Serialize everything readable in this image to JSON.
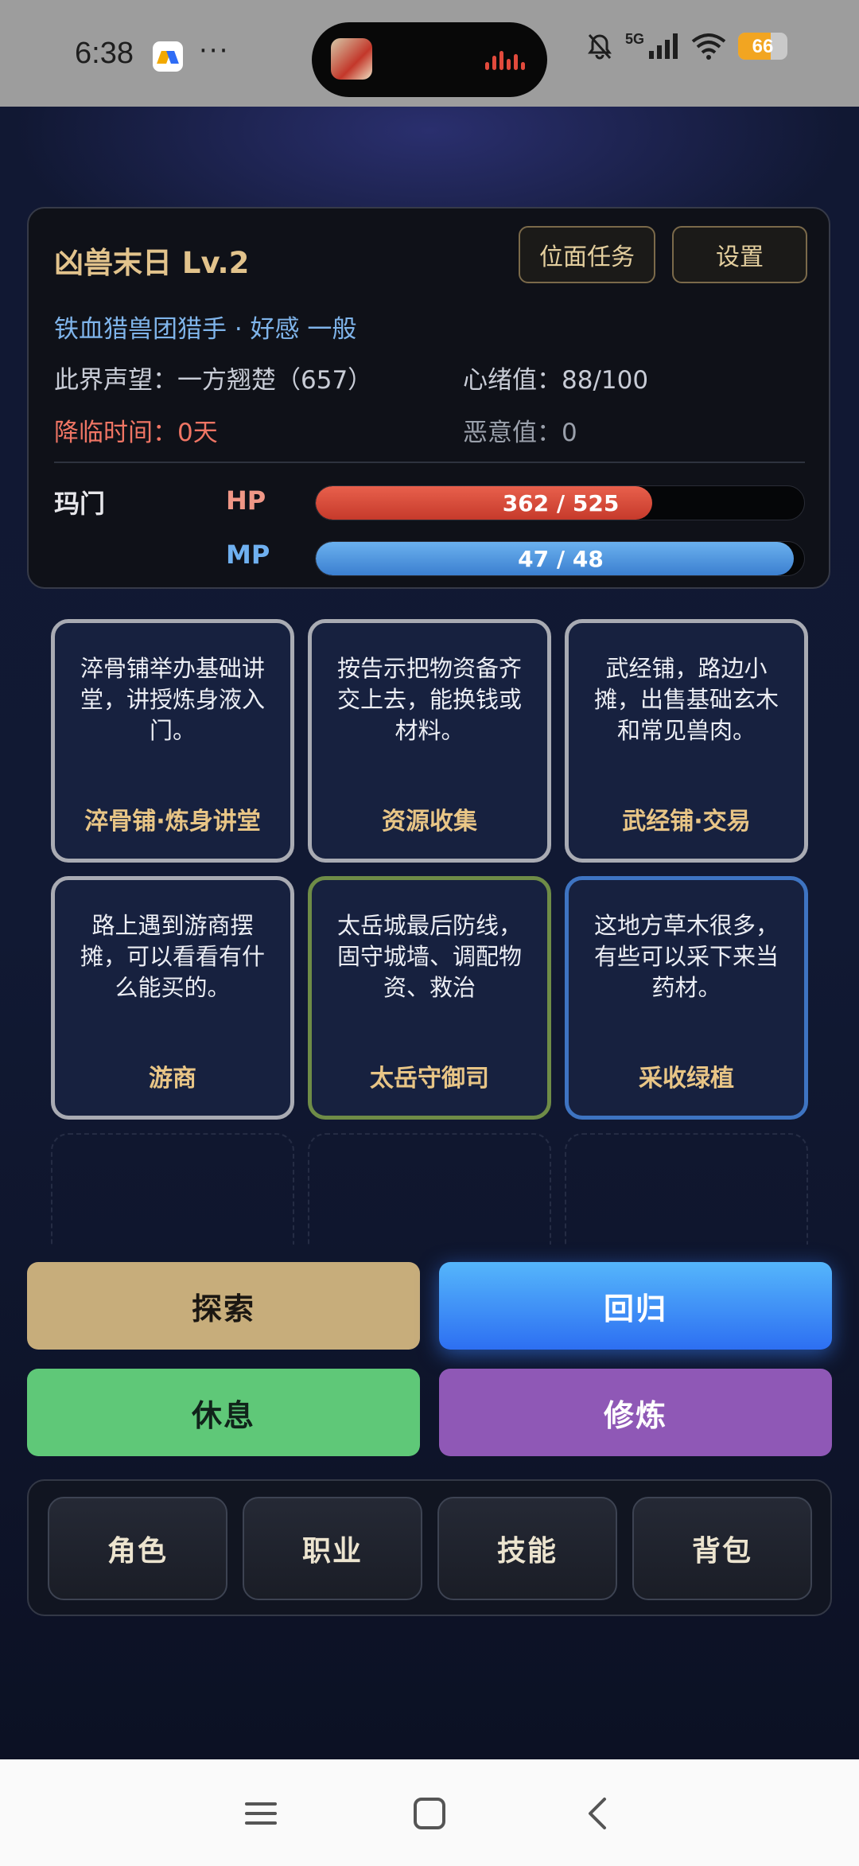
{
  "status_bar": {
    "time": "6:38",
    "dots": "···",
    "network": "5G",
    "battery": "66",
    "battery_level": 0.66,
    "icons": [
      "app-icon",
      "media-thumbnail-icon",
      "audio-wave-icon",
      "bell-muted-icon",
      "signal-icon",
      "wifi-icon",
      "battery-icon"
    ]
  },
  "header": {
    "title": "凶兽末日 Lv.2",
    "quest_button": "位面任务",
    "settings_button": "设置",
    "subtitle": "铁血猎兽团猎手 · 好感 一般",
    "reputation": "此界声望：一方翘楚（657）",
    "mood": "心绪值：88/100",
    "arrival_time": "降临时间：0天",
    "malice": "恶意值：0"
  },
  "companion": {
    "name": "玛门",
    "hp_label": "HP",
    "hp_text": "362 / 525",
    "hp_value": 362,
    "hp_max": 525,
    "mp_label": "MP",
    "mp_text": "47 / 48",
    "mp_value": 47,
    "mp_max": 48
  },
  "tiles": [
    {
      "desc": "淬骨铺举办基础讲堂，讲授炼身液入门。",
      "name": "淬骨铺·炼身讲堂",
      "style": "gray"
    },
    {
      "desc": "按告示把物资备齐交上去，能换钱或材料。",
      "name": "资源收集",
      "style": "gray"
    },
    {
      "desc": "武经铺，路边小摊，出售基础玄木和常见兽肉。",
      "name": "武经铺·交易",
      "style": "gray"
    },
    {
      "desc": "路上遇到游商摆摊，可以看看有什么能买的。",
      "name": "游商",
      "style": "gray"
    },
    {
      "desc": "太岳城最后防线，固守城墙、调配物资、救治",
      "name": "太岳守御司",
      "style": "green"
    },
    {
      "desc": "这地方草木很多，有些可以采下来当药材。",
      "name": "采收绿植",
      "style": "blue"
    }
  ],
  "actions": {
    "explore": "探索",
    "return": "回归",
    "rest": "休息",
    "train": "修炼"
  },
  "tabs": [
    "角色",
    "职业",
    "技能",
    "背包"
  ],
  "colors": {
    "gold": "#e2c38c",
    "hp": "#d84c3a",
    "mp": "#4a90dc",
    "explore": "#c7ad7b",
    "return": "#3a8cf6",
    "rest": "#5fc878",
    "train": "#8f58b6"
  }
}
